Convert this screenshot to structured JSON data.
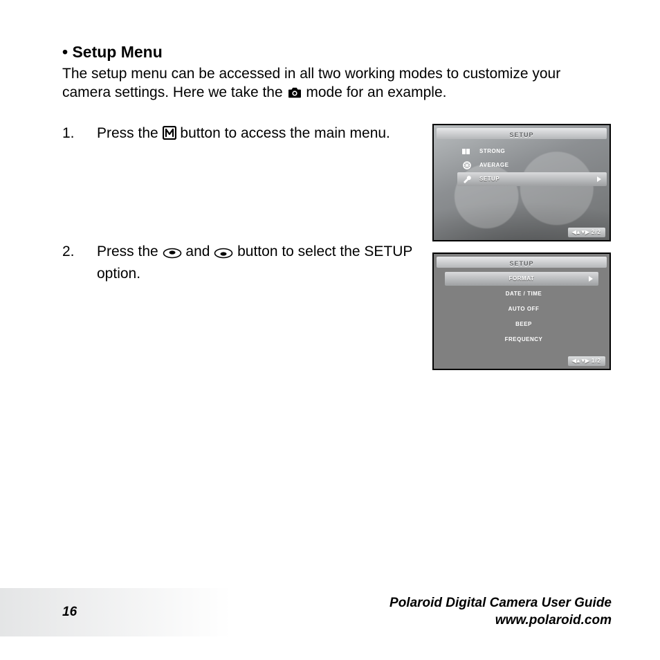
{
  "title": "• Setup Menu",
  "intro_part1": "The setup menu can be accessed in all two working modes to customize your camera settings. Here we take the ",
  "intro_part2": " mode for an example.",
  "steps": [
    {
      "num": "1.",
      "pre": "Press the ",
      "post": " button to access the main menu."
    },
    {
      "num": "2.",
      "pre": "Press the ",
      "mid": " and ",
      "post": " button to select the SETUP option."
    }
  ],
  "lcd1": {
    "title": "SETUP",
    "rows": [
      "STRONG",
      "AVERAGE",
      "SETUP"
    ],
    "selected_index": 2,
    "pager": "2/2",
    "arrows": "◀▲▼▶"
  },
  "lcd2": {
    "title": "SETUP",
    "rows": [
      "FORMAT",
      "DATE / TIME",
      "AUTO OFF",
      "BEEP",
      "FREQUENCY"
    ],
    "selected_index": 0,
    "pager": "1/2",
    "arrows": "◀▲▼▶"
  },
  "footer": {
    "page": "16",
    "guide": "Polaroid Digital Camera User Guide",
    "url": "www.polaroid.com"
  }
}
